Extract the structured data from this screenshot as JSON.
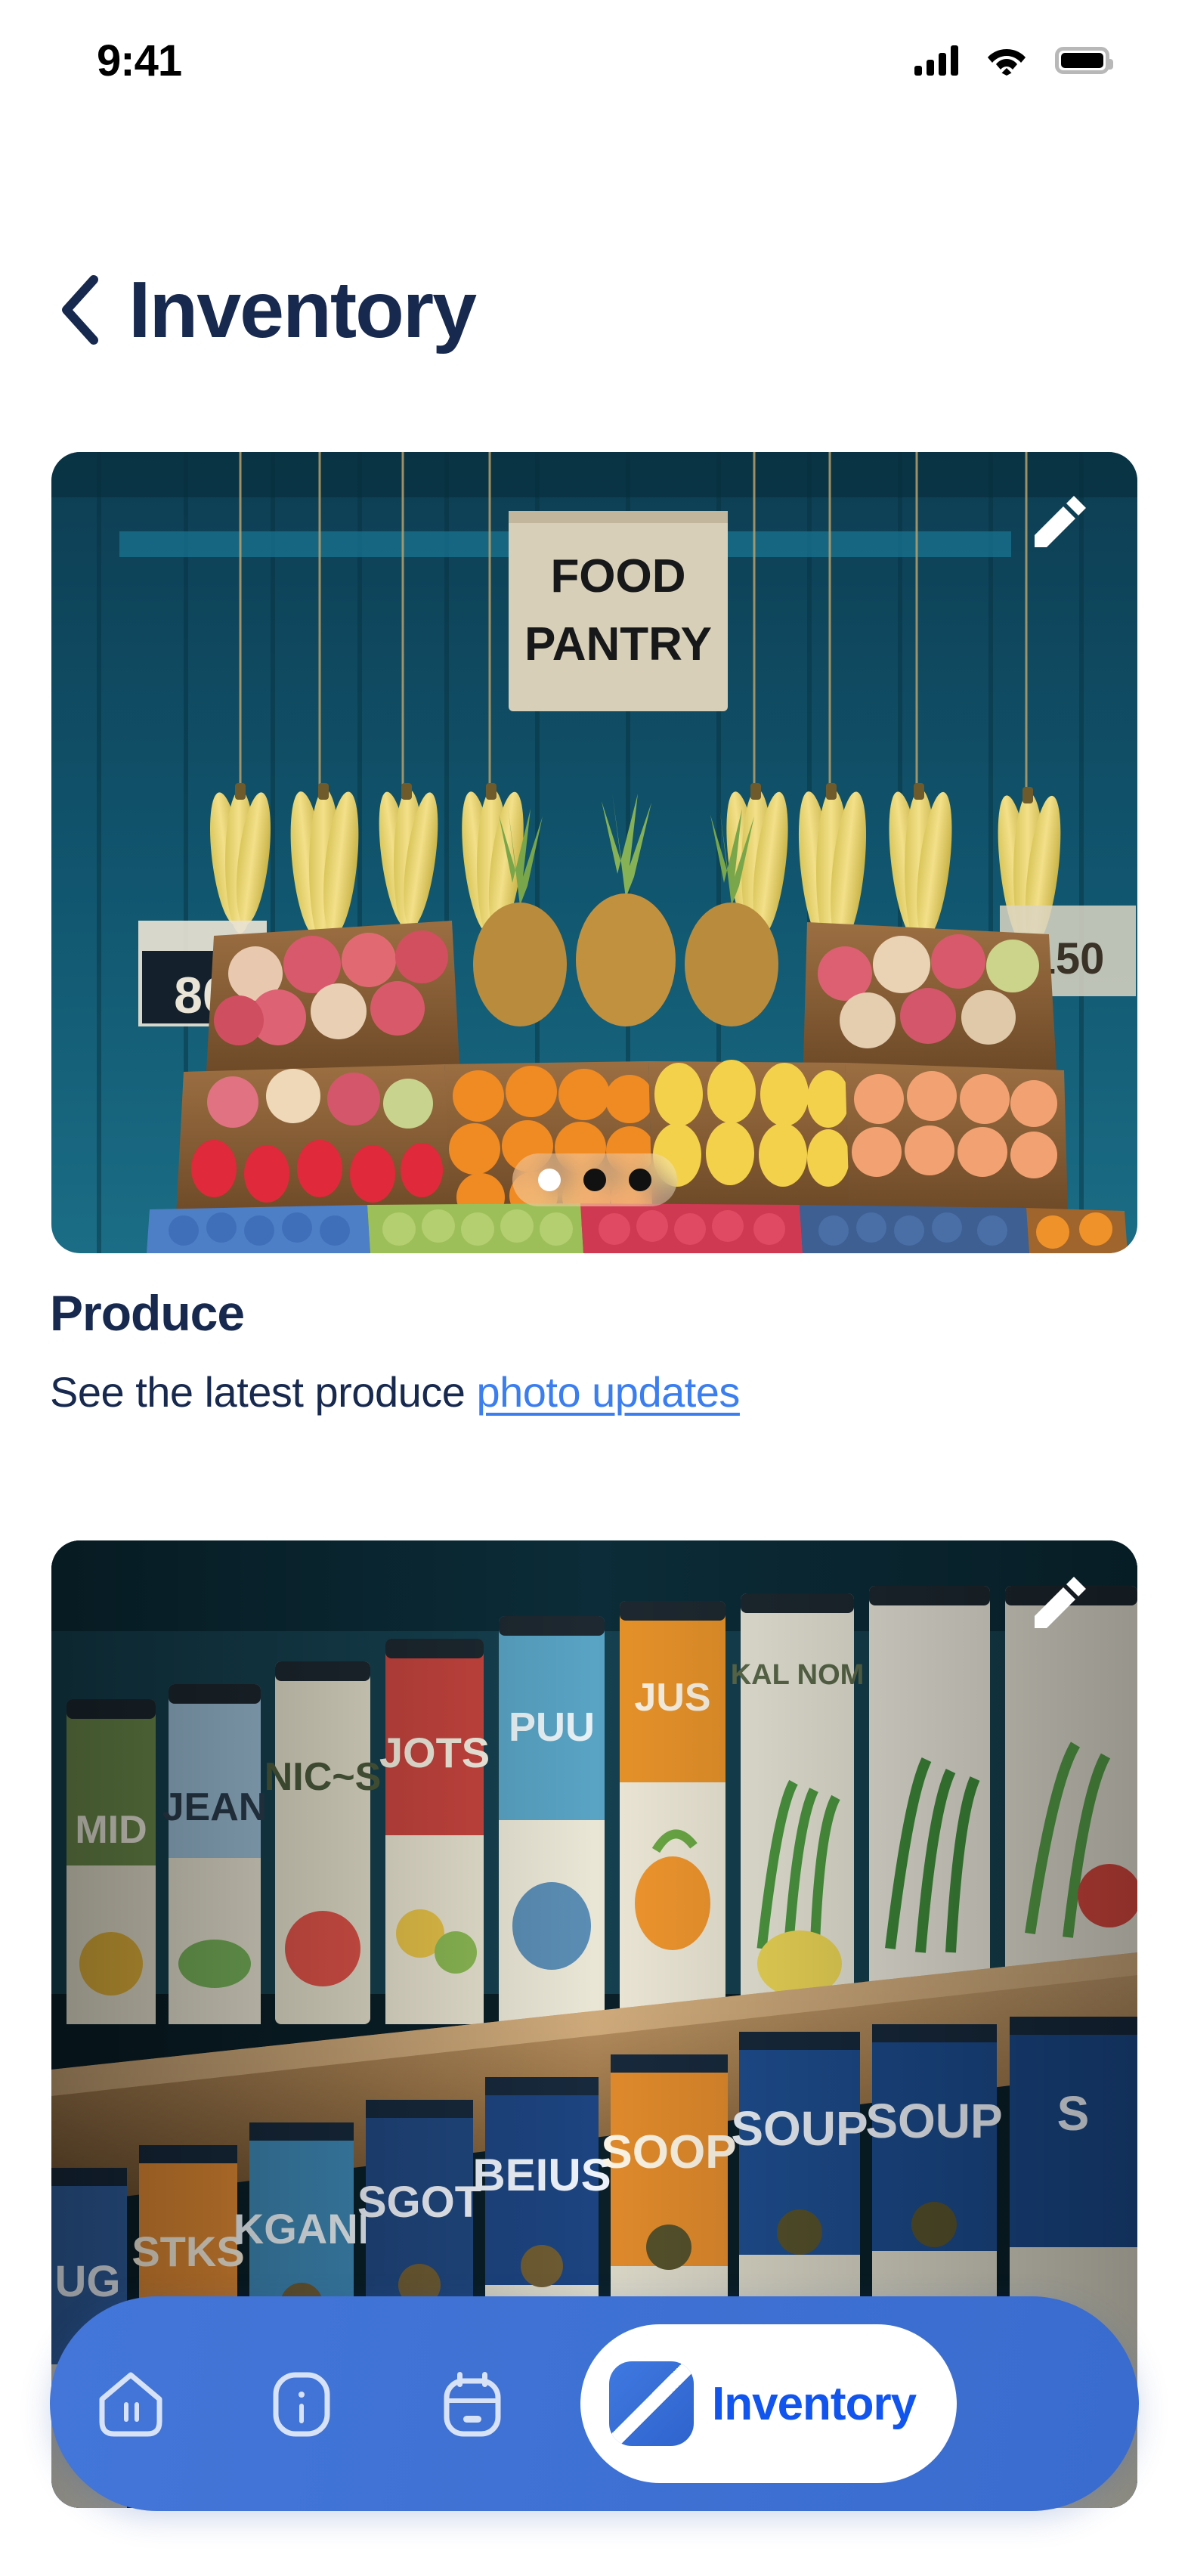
{
  "status_bar": {
    "time": "9:41",
    "icons": [
      "cellular-signal-icon",
      "wifi-icon",
      "battery-icon"
    ],
    "battery_full": true,
    "signal_bars": 4
  },
  "header": {
    "back_icon": "chevron-left-icon",
    "title": "Inventory"
  },
  "cards": [
    {
      "id": "produce",
      "name": "produce-photo-card",
      "alt": "Food pantry produce stand with hanging bananas and crates of fruit",
      "sign_text_line1": "FOOD",
      "sign_text_line2": "PANTRY",
      "price_tag_left": "86",
      "price_tag_right": "150",
      "edit_icon": "pencil-icon",
      "carousel": {
        "total": 3,
        "active_index": 0
      }
    },
    {
      "id": "canned",
      "name": "canned-goods-photo-card",
      "alt": "Shelves of canned goods with illustrated labels",
      "edit_icon": "pencil-icon",
      "can_labels_top": [
        "MID",
        "JEAN",
        "NIC~S",
        "JOTS",
        "PUU",
        "JUS",
        "KAL NOM"
      ],
      "can_labels_bottom": [
        "UG",
        "STKS",
        "KGANI",
        "SGOT",
        "BEIUS",
        "SOOP",
        "SOUP",
        "S"
      ]
    }
  ],
  "sections": [
    {
      "title": "Produce",
      "desc_prefix": "See the latest produce ",
      "link_label": "photo updates"
    }
  ],
  "bottom_nav": {
    "items": [
      {
        "name": "home",
        "icon": "home-icon",
        "active": false
      },
      {
        "name": "info",
        "icon": "info-icon",
        "active": false
      },
      {
        "name": "calendar",
        "icon": "calendar-icon",
        "active": false
      },
      {
        "name": "inventory",
        "icon": "inventory-slash-icon",
        "label": "Inventory",
        "active": true
      }
    ]
  },
  "colors": {
    "navy": "#17294f",
    "link_blue": "#3b7ef0",
    "nav_blue": "#4376d8",
    "active_label_blue": "#1155ee",
    "white": "#ffffff"
  }
}
